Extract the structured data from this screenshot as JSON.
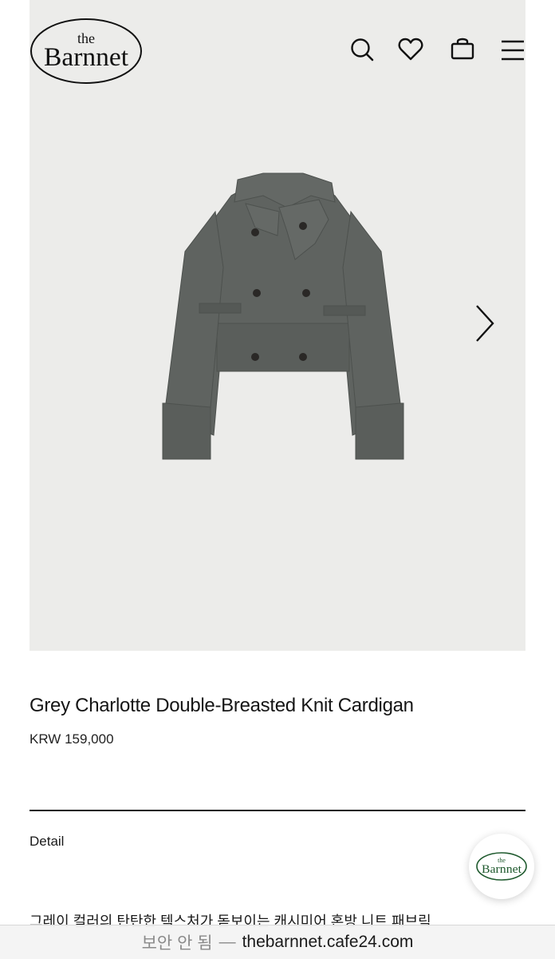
{
  "header": {
    "logo_the": "the",
    "logo_name": "Barnnet",
    "icons": [
      "search-icon",
      "heart-icon",
      "bag-icon",
      "menu-icon"
    ]
  },
  "gallery": {
    "background": "#ececea",
    "garment_color": "#5f6360",
    "next_icon": "chevron-right-icon"
  },
  "product": {
    "title": "Grey Charlotte Double-Breasted Knit Cardigan",
    "price": "KRW 159,000",
    "detail_label": "Detail",
    "description": "그레이 컬러의 탄탄한 텍스처가 돋보이는 캐시미어 혼방 니트 패브릭"
  },
  "floating_badge": {
    "logo_the": "the",
    "logo_name": "Barnnet",
    "accent": "#1f5a2e"
  },
  "browser": {
    "insecure_label": "보안 안 됨",
    "separator": "—",
    "domain": "thebarnnet.cafe24.com"
  }
}
